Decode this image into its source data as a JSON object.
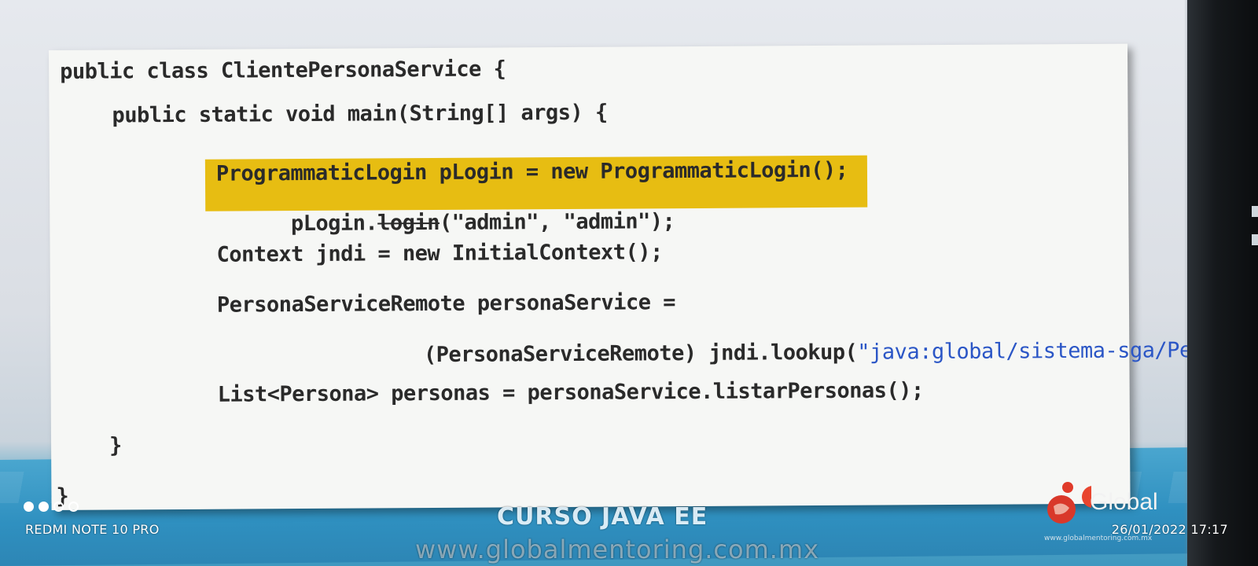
{
  "code": {
    "line1": "public class ClientePersonaService {",
    "line2": "public static void main(String[] args) {",
    "line3": "ProgrammaticLogin pLogin = new ProgrammaticLogin();",
    "line4_prefix": "pLogin.",
    "line4_struck": "login",
    "line4_suffix": "(\"admin\", \"admin\");",
    "line5": "Context jndi = new InitialContext();",
    "line6": "PersonaServiceRemote personaService =",
    "line7_prefix": "(PersonaServiceRemote) jndi.lookup(",
    "line7_string": "\"java:global/sistema-sga/Pe",
    "line8": "List<Persona> personas = personaService.listarPersonas();",
    "line9": "}",
    "line10": "}"
  },
  "slide": {
    "course_title": "CURSO JAVA EE",
    "course_url": "www.globalmentoring.com.mx",
    "logo_text": "Global",
    "logo_small": "www.globalmentoring.com.mx"
  },
  "camera_overlay": {
    "device": "REDMI NOTE 10 PRO",
    "datetime": "26/01/2022 17:17"
  },
  "colors": {
    "highlight": "#e7bd12",
    "string_literal": "#2b56c6",
    "slide_band": "#2f90c0"
  }
}
